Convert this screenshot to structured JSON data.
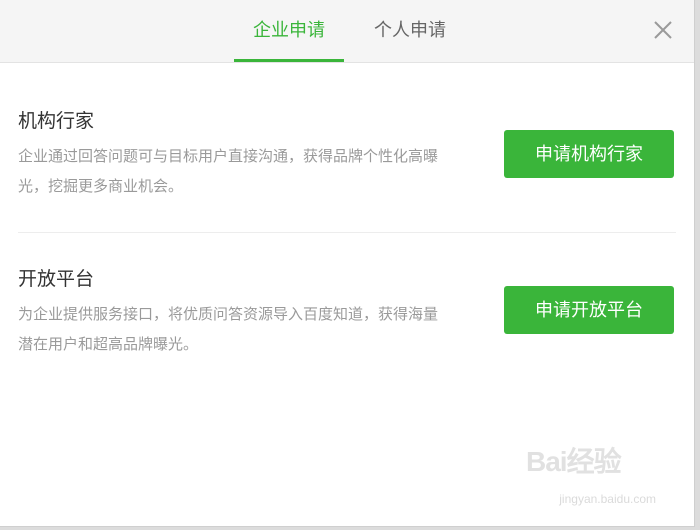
{
  "tabs": [
    {
      "label": "企业申请",
      "active": true
    },
    {
      "label": "个人申请",
      "active": false
    }
  ],
  "close_icon": "close-icon",
  "sections": [
    {
      "title": "机构行家",
      "description": "企业通过回答问题可与目标用户直接沟通，获得品牌个性化高曝光，挖掘更多商业机会。",
      "button_label": "申请机构行家"
    },
    {
      "title": "开放平台",
      "description": "为企业提供服务接口，将优质问答资源导入百度知道，获得海量潜在用户和超高品牌曝光。",
      "button_label": "申请开放平台"
    }
  ],
  "watermark": {
    "logo": "Bai经验",
    "url": "jingyan.baidu.com"
  },
  "colors": {
    "accent": "#3ab53a",
    "header_bg": "#f5f5f5",
    "muted_text": "#9a9a9a"
  }
}
